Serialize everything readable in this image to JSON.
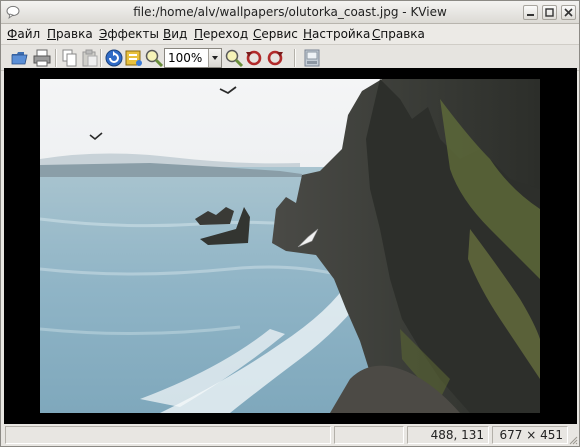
{
  "window": {
    "title": "file:/home/alv/wallpapers/olutorka_coast.jpg - KView",
    "icon": "speech-bubble-icon"
  },
  "menu": [
    "Файл",
    "Правка",
    "Эффекты",
    "Вид",
    "Переход",
    "Сервис",
    "Настройка",
    "Справка"
  ],
  "toolbar": {
    "zoom_value": "100%",
    "icons": [
      "open-icon",
      "print-icon",
      "copy-icon",
      "paste-icon",
      "reload-icon",
      "properties-icon",
      "zoom-icon",
      "zoom-in-icon",
      "rotate-left-icon",
      "rotate-right-icon",
      "slideshow-icon"
    ]
  },
  "status": {
    "message": "",
    "coords": "488, 131",
    "dimensions": "677 × 451"
  },
  "colors": {
    "sky": "#eef0f1",
    "sea": "#8fb4c6",
    "cliff": "#3e3f3a",
    "grass": "#5f6b3a",
    "background": "#000000"
  }
}
